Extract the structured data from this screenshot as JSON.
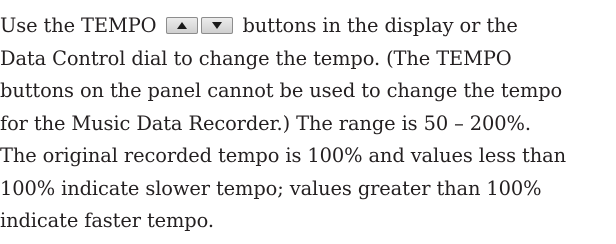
{
  "paragraph": {
    "line1_pre": "Use the TEMPO",
    "line1_post": "buttons in the display or the",
    "line2": "Data Control dial to change the tempo. (The TEMPO",
    "line3": "buttons on the panel cannot be used to change the tempo",
    "line4": "for the Music Data Recorder.) The range is 50 – 200%.",
    "line5": "The original recorded tempo is 100% and values less than",
    "line6": "100% indicate slower tempo; values greater than 100%",
    "line7": "indicate faster tempo."
  },
  "icons": {
    "up": "triangle-up-icon",
    "down": "triangle-down-icon"
  }
}
